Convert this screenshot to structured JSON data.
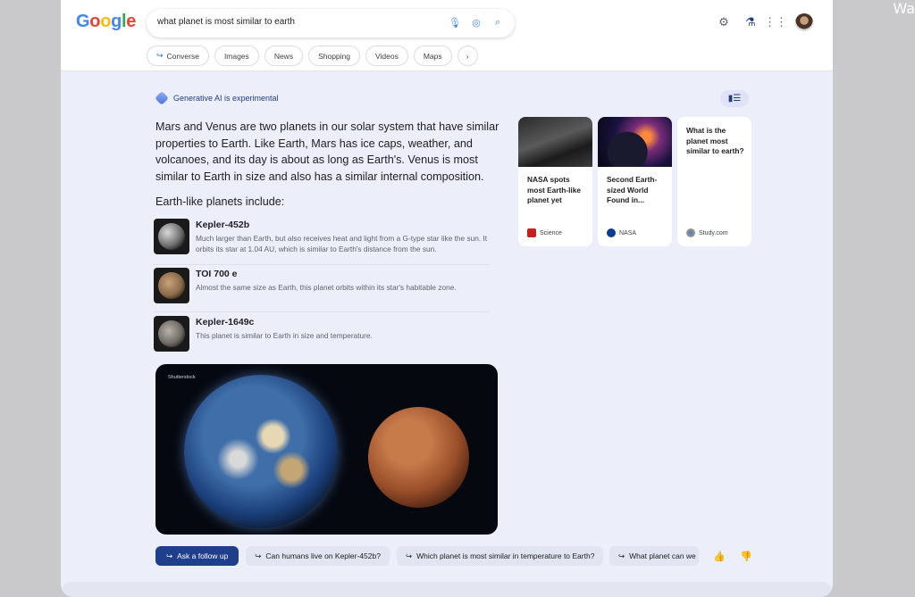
{
  "corner_text": "Wa",
  "logo": [
    "G",
    "o",
    "o",
    "g",
    "l",
    "e"
  ],
  "search": {
    "query": "what planet is most similar to earth"
  },
  "icons": {
    "mic": "microphone-icon",
    "lens": "camera-lens-icon",
    "search": "search-icon",
    "settings": "gear-icon",
    "labs": "flask-icon",
    "apps": "apps-grid-icon"
  },
  "chips": [
    "Converse",
    "Images",
    "News",
    "Shopping",
    "Videos",
    "Maps"
  ],
  "ai": {
    "label": "Generative AI is experimental",
    "summary": "Mars and Venus are two planets in our solar system that have similar properties to Earth. Like Earth, Mars has ice caps, weather, and volcanoes, and its day is about as long as Earth's. Venus is most similar to Earth in size and also has a similar internal composition.",
    "subhead": "Earth-like planets include:"
  },
  "planets": [
    {
      "name": "Kepler-452b",
      "desc": "Much larger than Earth, but also receives heat and light from a G-type star like the sun. It orbits its star at 1.04 AU, which is similar to Earth's distance from the sun."
    },
    {
      "name": "TOI 700 e",
      "desc": "Almost the same size as Earth, this planet orbits within its star's habitable zone."
    },
    {
      "name": "Kepler-1649c",
      "desc": "This planet is similar to Earth in size and temperature."
    }
  ],
  "hero": {
    "credit": "Shutterstock"
  },
  "cards": [
    {
      "title": "NASA spots most Earth-like planet yet",
      "source": "Science",
      "color": "#c5221f"
    },
    {
      "title": "Second Earth-sized World Found in...",
      "source": "NASA",
      "color": "#0b3d91"
    },
    {
      "title": "What is the planet most similar to earth?",
      "source": "Study.com",
      "color": "#5f6368"
    }
  ],
  "followups": {
    "ask": "Ask a follow up",
    "items": [
      "Can humans live on Kepler-452b?",
      "Which planet is most similar in temperature to Earth?",
      "What planet can we"
    ]
  },
  "colors": {
    "accent": "#1f3e8c",
    "page_bg": "#eceefa"
  }
}
